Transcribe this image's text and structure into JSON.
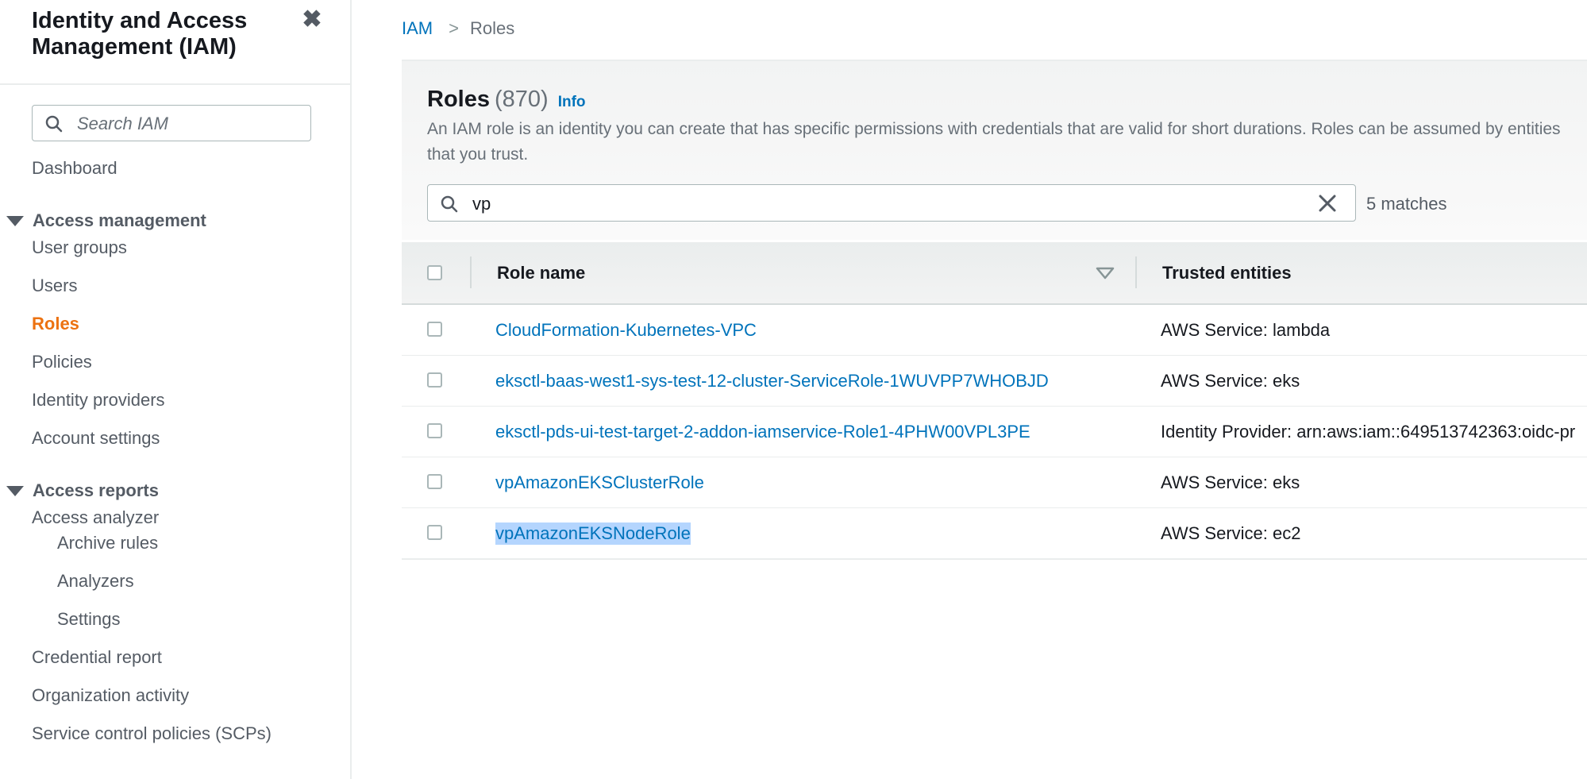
{
  "sidebar": {
    "title": "Identity and Access Management (IAM)",
    "close_icon": "close-icon",
    "search_placeholder": "Search IAM",
    "dashboard": "Dashboard",
    "access_management": {
      "label": "Access management",
      "items": [
        "User groups",
        "Users",
        "Roles",
        "Policies",
        "Identity providers",
        "Account settings"
      ],
      "active": "Roles"
    },
    "access_reports": {
      "label": "Access reports",
      "analyzer": "Access analyzer",
      "analyzer_items": [
        "Archive rules",
        "Analyzers",
        "Settings"
      ],
      "items": [
        "Credential report",
        "Organization activity",
        "Service control policies (SCPs)"
      ]
    }
  },
  "breadcrumb": {
    "root": "IAM",
    "separator": ">",
    "current": "Roles"
  },
  "roles_panel": {
    "title": "Roles",
    "count": "(870)",
    "info_link": "Info",
    "description": "An IAM role is an identity you can create that has specific permissions with credentials that are valid for short durations. Roles can be assumed by entities that you trust.",
    "filter_value": "vp",
    "matches": "5 matches",
    "columns": [
      "Role name",
      "Trusted entities"
    ],
    "rows": [
      {
        "role_name": "CloudFormation-Kubernetes-VPC",
        "trusted_entities": "AWS Service: lambda"
      },
      {
        "role_name": "eksctl-baas-west1-sys-test-12-cluster-ServiceRole-1WUVPP7WHOBJD",
        "trusted_entities": "AWS Service: eks"
      },
      {
        "role_name": "eksctl-pds-ui-test-target-2-addon-iamservice-Role1-4PHW00VPL3PE",
        "trusted_entities": "Identity Provider: arn:aws:iam::649513742363:oidc-pr"
      },
      {
        "role_name": "vpAmazonEKSClusterRole",
        "trusted_entities": "AWS Service: eks"
      },
      {
        "role_name": "vpAmazonEKSNodeRole",
        "trusted_entities": "AWS Service: ec2"
      }
    ]
  },
  "colors": {
    "link": "#0073bb",
    "active_nav": "#ec7211",
    "text_selection": "#b4d5fe"
  }
}
